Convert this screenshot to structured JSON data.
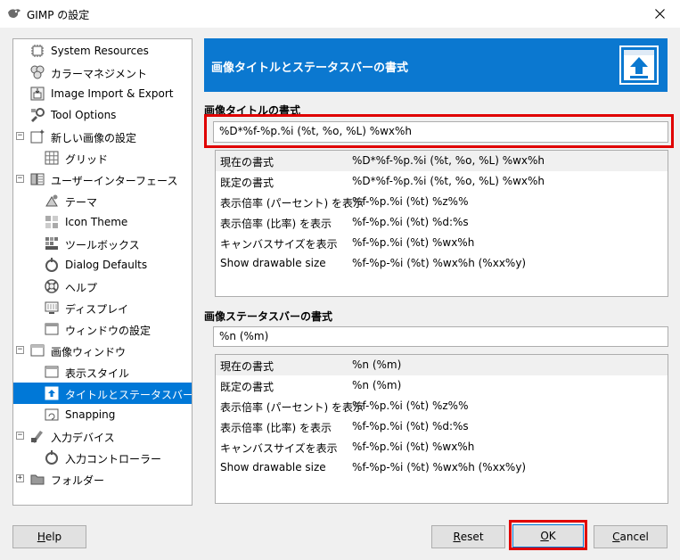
{
  "window": {
    "title": "GIMP の設定"
  },
  "sidebar": {
    "items": [
      {
        "label": "System Resources",
        "icon": "chip-icon"
      },
      {
        "label": "カラーマネジメント",
        "icon": "color-circles-icon"
      },
      {
        "label": "Image Import & Export",
        "icon": "image-import-icon"
      },
      {
        "label": "Tool Options",
        "icon": "tool-options-icon"
      },
      {
        "label": "新しい画像の設定",
        "icon": "new-image-icon",
        "expander": "−"
      },
      {
        "label": "グリッド",
        "icon": "grid-icon"
      },
      {
        "label": "ユーザーインターフェース",
        "icon": "user-interface-icon",
        "expander": "−"
      },
      {
        "label": "テーマ",
        "icon": "theme-icon"
      },
      {
        "label": "Icon Theme",
        "icon": "icon-theme-icon"
      },
      {
        "label": "ツールボックス",
        "icon": "toolbox-icon"
      },
      {
        "label": "Dialog Defaults",
        "icon": "dialog-defaults-icon"
      },
      {
        "label": "ヘルプ",
        "icon": "help-lifebuoy-icon"
      },
      {
        "label": "ディスプレイ",
        "icon": "display-icon"
      },
      {
        "label": "ウィンドウの設定",
        "icon": "window-settings-icon"
      },
      {
        "label": "画像ウィンドウ",
        "icon": "image-window-icon",
        "expander": "−"
      },
      {
        "label": "表示スタイル",
        "icon": "appearance-icon"
      },
      {
        "label": "タイトルとステータスバー",
        "icon": "title-statusbar-icon"
      },
      {
        "label": "Snapping",
        "icon": "snapping-icon"
      },
      {
        "label": "入力デバイス",
        "icon": "input-devices-icon",
        "expander": "−"
      },
      {
        "label": "入力コントローラー",
        "icon": "input-controllers-icon"
      },
      {
        "label": "フォルダー",
        "icon": "folder-icon",
        "expander": "+"
      }
    ],
    "selected_index": 16
  },
  "banner": {
    "title": "画像タイトルとステータスバーの書式"
  },
  "title_format": {
    "label": "画像タイトルの書式",
    "value": "%D*%f-%p.%i (%t, %o, %L) %wx%h",
    "rows": [
      {
        "name": "現在の書式",
        "value": "%D*%f-%p.%i (%t, %o, %L) %wx%h"
      },
      {
        "name": "既定の書式",
        "value": "%D*%f-%p.%i (%t, %o, %L) %wx%h"
      },
      {
        "name": "表示倍率 (パーセント) を表示",
        "value": "%f-%p.%i (%t) %z%%"
      },
      {
        "name": "表示倍率 (比率) を表示",
        "value": "%f-%p.%i (%t) %d:%s"
      },
      {
        "name": "キャンバスサイズを表示",
        "value": "%f-%p.%i (%t) %wx%h"
      },
      {
        "name": "Show drawable size",
        "value": "%f-%p-%i (%t) %wx%h (%xx%y)"
      }
    ]
  },
  "status_format": {
    "label": "画像ステータスバーの書式",
    "value": "%n (%m)",
    "rows": [
      {
        "name": "現在の書式",
        "value": "%n (%m)"
      },
      {
        "name": "既定の書式",
        "value": "%n (%m)"
      },
      {
        "name": "表示倍率 (パーセント) を表示",
        "value": "%f-%p.%i (%t) %z%%"
      },
      {
        "name": "表示倍率 (比率) を表示",
        "value": "%f-%p.%i (%t) %d:%s"
      },
      {
        "name": "キャンバスサイズを表示",
        "value": "%f-%p.%i (%t) %wx%h"
      },
      {
        "name": "Show drawable size",
        "value": "%f-%p-%i (%t) %wx%h (%xx%y)"
      }
    ]
  },
  "buttons": {
    "help": {
      "mnemonic": "H",
      "rest": "elp"
    },
    "reset": {
      "mnemonic": "R",
      "rest": "eset"
    },
    "ok": {
      "mnemonic": "O",
      "rest": "K"
    },
    "cancel": {
      "mnemonic": "C",
      "rest": "ancel"
    }
  },
  "colors": {
    "accent": "#0078d7",
    "banner": "#0b78d0",
    "highlight": "#e00000"
  }
}
